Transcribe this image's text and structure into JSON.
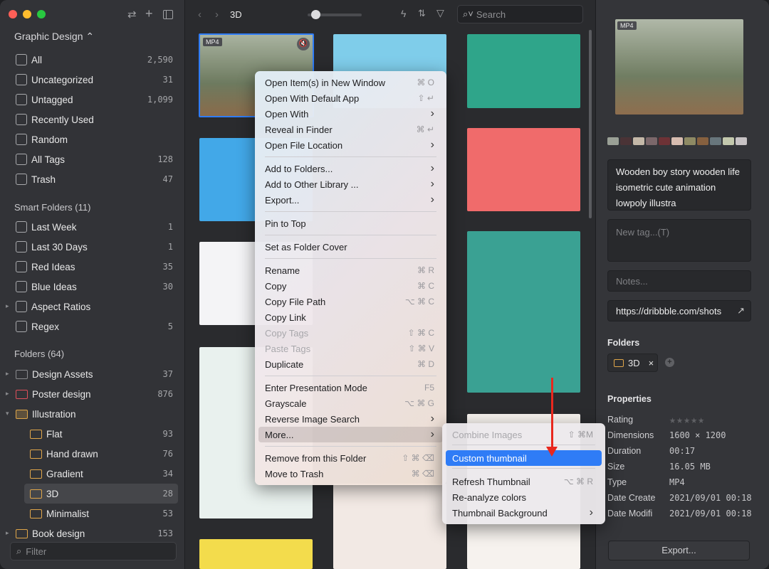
{
  "sidebar": {
    "library": "Graphic Design ⌃",
    "items": [
      {
        "label": "All",
        "count": "2,590"
      },
      {
        "label": "Uncategorized",
        "count": "31"
      },
      {
        "label": "Untagged",
        "count": "1,099"
      },
      {
        "label": "Recently Used",
        "count": ""
      },
      {
        "label": "Random",
        "count": ""
      },
      {
        "label": "All Tags",
        "count": "128"
      },
      {
        "label": "Trash",
        "count": "47"
      }
    ],
    "smart_header": "Smart Folders (11)",
    "smart": [
      {
        "label": "Last Week",
        "count": "1",
        "icon": "calendar-7-icon"
      },
      {
        "label": "Last 30 Days",
        "count": "1",
        "icon": "calendar-31-icon"
      },
      {
        "label": "Red Ideas",
        "count": "35",
        "icon": "smart-folder-icon"
      },
      {
        "label": "Blue Ideas",
        "count": "30",
        "icon": "smart-folder-icon"
      },
      {
        "label": "Aspect Ratios",
        "count": "",
        "icon": "grid-icon"
      },
      {
        "label": "Regex",
        "count": "5",
        "icon": "smart-folder-icon"
      }
    ],
    "folders_header": "Folders (64)",
    "folders": [
      {
        "label": "Design Assets",
        "count": "37",
        "color": "#8a8b8e"
      },
      {
        "label": "Poster design",
        "count": "876",
        "color": "#e0505a"
      },
      {
        "label": "Illustration",
        "count": "",
        "color": "#e0a64a"
      },
      {
        "label": "Flat",
        "count": "93",
        "color": "#e0a64a"
      },
      {
        "label": "Hand drawn",
        "count": "76",
        "color": "#e0a64a"
      },
      {
        "label": "Gradient",
        "count": "34",
        "color": "#e0a64a"
      },
      {
        "label": "3D",
        "count": "28",
        "color": "#e0a64a"
      },
      {
        "label": "Minimalist",
        "count": "53",
        "color": "#e0a64a"
      },
      {
        "label": "Book design",
        "count": "153",
        "color": "#e0a64a"
      }
    ],
    "filter_placeholder": "Filter"
  },
  "toolbar": {
    "title": "3D",
    "search_placeholder": "Search",
    "zoom_level": 0.15
  },
  "grid": {
    "badge": "MP4"
  },
  "context_menu": {
    "items": [
      {
        "label": "Open Item(s) in New Window",
        "shortcut": "⌘ O"
      },
      {
        "label": "Open With Default App",
        "shortcut": "⇧ ↵"
      },
      {
        "label": "Open With",
        "shortcut": "›"
      },
      {
        "label": "Reveal in Finder",
        "shortcut": "⌘ ↵"
      },
      {
        "label": "Open File Location",
        "shortcut": "›"
      },
      {
        "label": "Add to Folders...",
        "shortcut": "›"
      },
      {
        "label": "Add to Other Library ...",
        "shortcut": "›"
      },
      {
        "label": "Export...",
        "shortcut": "›"
      },
      {
        "label": "Pin to Top",
        "shortcut": ""
      },
      {
        "label": "Set as Folder Cover",
        "shortcut": ""
      },
      {
        "label": "Rename",
        "shortcut": "⌘ R"
      },
      {
        "label": "Copy",
        "shortcut": "⌘ C"
      },
      {
        "label": "Copy File Path",
        "shortcut": "⌥ ⌘ C"
      },
      {
        "label": "Copy Link",
        "shortcut": ""
      },
      {
        "label": "Copy Tags",
        "shortcut": "⇧ ⌘ C",
        "disabled": true
      },
      {
        "label": "Paste Tags",
        "shortcut": "⇧ ⌘ V",
        "disabled": true
      },
      {
        "label": "Duplicate",
        "shortcut": "⌘ D"
      },
      {
        "label": "Enter Presentation Mode",
        "shortcut": "F5"
      },
      {
        "label": "Grayscale",
        "shortcut": "⌥ ⌘ G"
      },
      {
        "label": "Reverse Image Search",
        "shortcut": "›"
      },
      {
        "label": "More...",
        "shortcut": "›"
      },
      {
        "label": "Remove from this Folder",
        "shortcut": "⇧ ⌘ ⌫"
      },
      {
        "label": "Move to Trash",
        "shortcut": "⌘ ⌫"
      }
    ]
  },
  "submenu": {
    "items": [
      {
        "label": "Combine Images",
        "shortcut": "⇧ ⌘M",
        "disabled": true
      },
      {
        "label": "Custom thumbnail",
        "shortcut": "",
        "selected": true
      },
      {
        "label": "Refresh Thumbnail",
        "shortcut": "⌥ ⌘ R"
      },
      {
        "label": "Re-analyze colors",
        "shortcut": ""
      },
      {
        "label": "Thumbnail Background",
        "shortcut": "›"
      }
    ],
    "highlight_color": "#2f7cf6"
  },
  "inspector": {
    "badge": "MP4",
    "palette": [
      "#9aa096",
      "#4a3336",
      "#c4b8a8",
      "#7b676a",
      "#6e3236",
      "#d7bcb0",
      "#8e8a64",
      "#86603f",
      "#68767c",
      "#c3c8ad",
      "#c7c2c4"
    ],
    "name": "Wooden boy story wooden life isometric cute animation lowpoly illustra",
    "tag_placeholder": "New tag...(T)",
    "notes_placeholder": "Notes...",
    "url": "https://dribbble.com/shots",
    "folders_title": "Folders",
    "folder_chip": "3D",
    "properties_title": "Properties",
    "rating": 0,
    "props": [
      {
        "label": "Rating",
        "value": ""
      },
      {
        "label": "Dimensions",
        "value": "1600 × 1200"
      },
      {
        "label": "Duration",
        "value": "00:17"
      },
      {
        "label": "Size",
        "value": "16.05 MB"
      },
      {
        "label": "Type",
        "value": "MP4"
      },
      {
        "label": "Date Create",
        "value": "2021/09/01 00:18"
      },
      {
        "label": "Date Modifi",
        "value": "2021/09/01 00:18"
      }
    ],
    "export_label": "Export..."
  }
}
